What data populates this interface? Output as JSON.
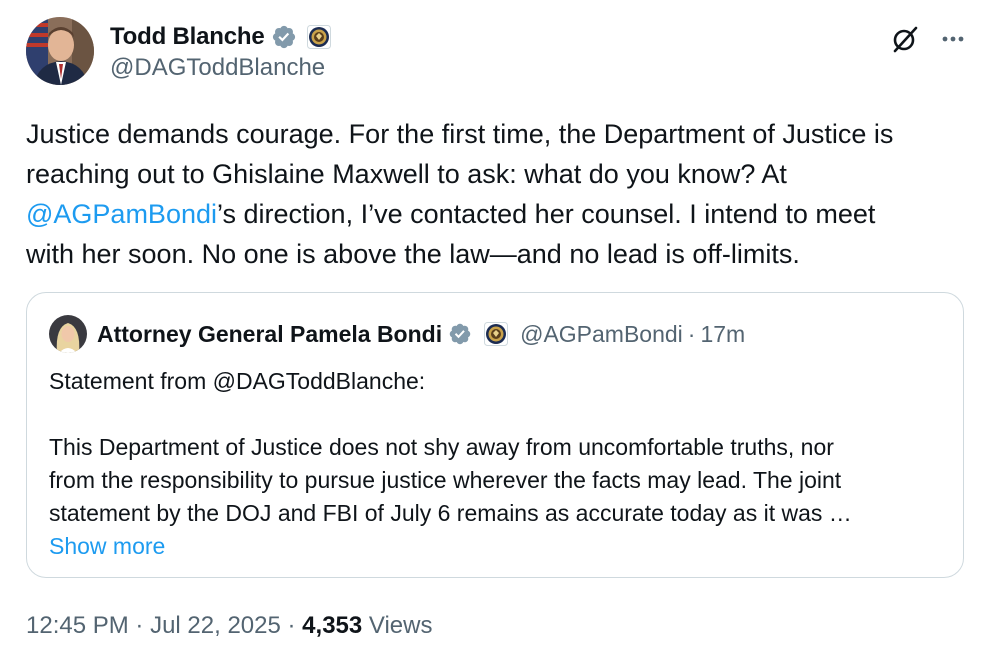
{
  "author": {
    "name": "Todd Blanche",
    "handle": "@DAGToddBlanche"
  },
  "tweet": {
    "text_line1": "Justice demands courage. For the first time, the Department of Justice is",
    "text_line2": "reaching out to Ghislaine Maxwell to ask: what do you know? At",
    "mention": "@AGPamBondi",
    "text_line3_rest": "’s direction, I’ve contacted her counsel. I intend to meet",
    "text_line4": "with her soon. No one is above the law—and no lead is off-limits."
  },
  "quote": {
    "name": "Attorney General Pamela Bondi",
    "handle": "@AGPamBondi",
    "separator": "·",
    "time": "17m",
    "line1": "Statement from @DAGToddBlanche:",
    "line2": "This Department of Justice does not shy away from uncomfortable truths, nor",
    "line3": "from the responsibility to pursue justice wherever the facts may lead.  The joint",
    "line4": "statement by the DOJ and FBI of July 6 remains as accurate today as it was …",
    "show_more": "Show more"
  },
  "meta": {
    "time": "12:45 PM",
    "sep1": " · ",
    "date": "Jul 22, 2025",
    "sep2": " · ",
    "views_count": "4,353",
    "views_label": " Views"
  },
  "colors": {
    "accent": "#1d9bf0",
    "secondary_text": "#536471",
    "primary_text": "#0f1419",
    "border": "#cfd9de",
    "verified_badge": "#829aab"
  },
  "icons": {
    "verified": "verified-badge-icon",
    "seal": "doj-seal-icon",
    "grok": "grok-icon",
    "more": "more-options-icon"
  }
}
